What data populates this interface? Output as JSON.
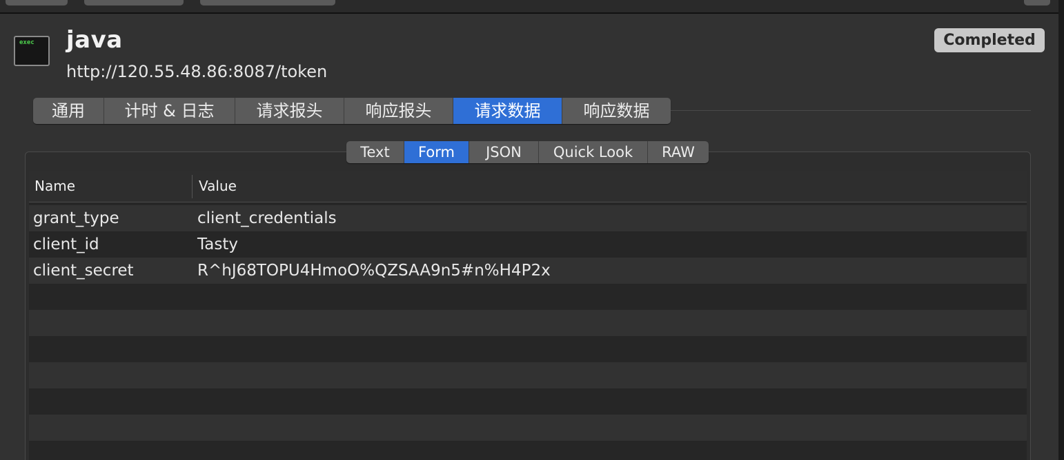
{
  "header": {
    "title": "java",
    "url": "http://120.55.48.86:8087/token",
    "status": "Completed",
    "icon_label": "exec"
  },
  "main_tabs": [
    {
      "label": "通用",
      "active": false
    },
    {
      "label": "计时 & 日志",
      "active": false
    },
    {
      "label": "请求报头",
      "active": false
    },
    {
      "label": "响应报头",
      "active": false
    },
    {
      "label": "请求数据",
      "active": true
    },
    {
      "label": "响应数据",
      "active": false
    }
  ],
  "sub_tabs": [
    {
      "label": "Text",
      "active": false
    },
    {
      "label": "Form",
      "active": true
    },
    {
      "label": "JSON",
      "active": false
    },
    {
      "label": "Quick Look",
      "active": false
    },
    {
      "label": "RAW",
      "active": false
    }
  ],
  "table": {
    "columns": [
      "Name",
      "Value"
    ],
    "rows": [
      {
        "name": "grant_type",
        "value": "client_credentials"
      },
      {
        "name": "client_id",
        "value": "Tasty"
      },
      {
        "name": "client_secret",
        "value": "R^hJ68TOPU4HmoO%QZSAA9n5#n%H4P2x"
      }
    ]
  },
  "colors": {
    "accent": "#2f6fd6",
    "background": "#323232",
    "badge": "#c9c9c9"
  }
}
